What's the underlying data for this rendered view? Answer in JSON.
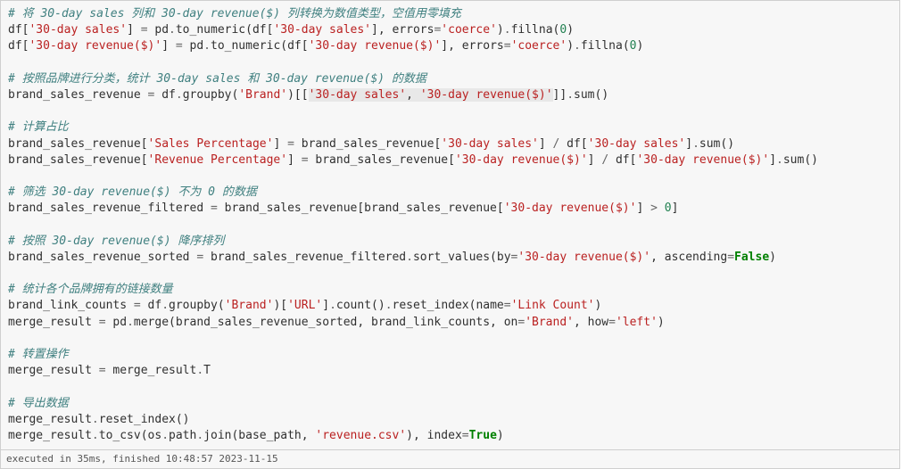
{
  "code": {
    "c1": "# 将 30-day sales 列和 30-day revenue($) 列转换为数值类型，空值用零填充",
    "l2_a": "df[",
    "l2_b": "'30-day sales'",
    "l2_c": "] ",
    "l2_op1": "=",
    "l2_d": " pd",
    "l2_dot1": ".",
    "l2_e": "to_numeric(df[",
    "l2_f": "'30-day sales'",
    "l2_g": "], errors",
    "l2_op2": "=",
    "l2_h": "'coerce'",
    "l2_i": ")",
    "l2_dot2": ".",
    "l2_j": "fillna(",
    "l2_k": "0",
    "l2_l": ")",
    "l3_a": "df[",
    "l3_b": "'30-day revenue($)'",
    "l3_c": "] ",
    "l3_op1": "=",
    "l3_d": " pd",
    "l3_dot1": ".",
    "l3_e": "to_numeric(df[",
    "l3_f": "'30-day revenue($)'",
    "l3_g": "], errors",
    "l3_op2": "=",
    "l3_h": "'coerce'",
    "l3_i": ")",
    "l3_dot2": ".",
    "l3_j": "fillna(",
    "l3_k": "0",
    "l3_l": ")",
    "c2": "# 按照品牌进行分类，统计 30-day sales 和 30-day revenue($) 的数据",
    "l5_a": "brand_sales_revenue ",
    "l5_op1": "=",
    "l5_b": " df",
    "l5_dot1": ".",
    "l5_c": "groupby(",
    "l5_d": "'Brand'",
    "l5_e": ")[[",
    "l5_f": "'30-day sales'",
    "l5_g": ", ",
    "l5_h": "'30-day revenue($)'",
    "l5_i": "]]",
    "l5_dot2": ".",
    "l5_j": "sum()",
    "c3": "# 计算占比",
    "l7_a": "brand_sales_revenue[",
    "l7_b": "'Sales Percentage'",
    "l7_c": "] ",
    "l7_op1": "=",
    "l7_d": " brand_sales_revenue[",
    "l7_e": "'30-day sales'",
    "l7_f": "] ",
    "l7_op2": "/",
    "l7_g": " df[",
    "l7_h": "'30-day sales'",
    "l7_i": "]",
    "l7_dot1": ".",
    "l7_j": "sum()",
    "l8_a": "brand_sales_revenue[",
    "l8_b": "'Revenue Percentage'",
    "l8_c": "] ",
    "l8_op1": "=",
    "l8_d": " brand_sales_revenue[",
    "l8_e": "'30-day revenue($)'",
    "l8_f": "] ",
    "l8_op2": "/",
    "l8_g": " df[",
    "l8_h": "'30-day revenue($)'",
    "l8_i": "]",
    "l8_dot1": ".",
    "l8_j": "sum()",
    "c4": "# 筛选 30-day revenue($) 不为 0 的数据",
    "l10_a": "brand_sales_revenue_filtered ",
    "l10_op1": "=",
    "l10_b": " brand_sales_revenue[brand_sales_revenue[",
    "l10_c": "'30-day revenue($)'",
    "l10_d": "] ",
    "l10_op2": ">",
    "l10_e": " ",
    "l10_f": "0",
    "l10_g": "]",
    "c5": "# 按照 30-day revenue($) 降序排列",
    "l12_a": "brand_sales_revenue_sorted ",
    "l12_op1": "=",
    "l12_b": " brand_sales_revenue_filtered",
    "l12_dot1": ".",
    "l12_c": "sort_values(by",
    "l12_op2": "=",
    "l12_d": "'30-day revenue($)'",
    "l12_e": ", ascending",
    "l12_op3": "=",
    "l12_f": "False",
    "l12_g": ")",
    "c6": "# 统计各个品牌拥有的链接数量",
    "l14_a": "brand_link_counts ",
    "l14_op1": "=",
    "l14_b": " df",
    "l14_dot1": ".",
    "l14_c": "groupby(",
    "l14_d": "'Brand'",
    "l14_e": ")[",
    "l14_f": "'URL'",
    "l14_g": "]",
    "l14_dot2": ".",
    "l14_h": "count()",
    "l14_dot3": ".",
    "l14_i": "reset_index(name",
    "l14_op2": "=",
    "l14_j": "'Link Count'",
    "l14_k": ")",
    "l15_a": "merge_result ",
    "l15_op1": "=",
    "l15_b": " pd",
    "l15_dot1": ".",
    "l15_c": "merge(brand_sales_revenue_sorted, brand_link_counts, on",
    "l15_op2": "=",
    "l15_d": "'Brand'",
    "l15_e": ", how",
    "l15_op3": "=",
    "l15_f": "'left'",
    "l15_g": ")",
    "c7": "# 转置操作",
    "l17_a": "merge_result ",
    "l17_op1": "=",
    "l17_b": " merge_result",
    "l17_dot1": ".",
    "l17_c": "T",
    "c8": "# 导出数据",
    "l19_a": "merge_result",
    "l19_dot1": ".",
    "l19_b": "reset_index()",
    "l20_a": "merge_result",
    "l20_dot1": ".",
    "l20_b": "to_csv(os",
    "l20_dot2": ".",
    "l20_c": "path",
    "l20_dot3": ".",
    "l20_d": "join(base_path, ",
    "l20_e": "'revenue.csv'",
    "l20_f": "), index",
    "l20_op1": "=",
    "l20_g": "True",
    "l20_h": ")"
  },
  "status": "executed in 35ms, finished 10:48:57 2023-11-15"
}
